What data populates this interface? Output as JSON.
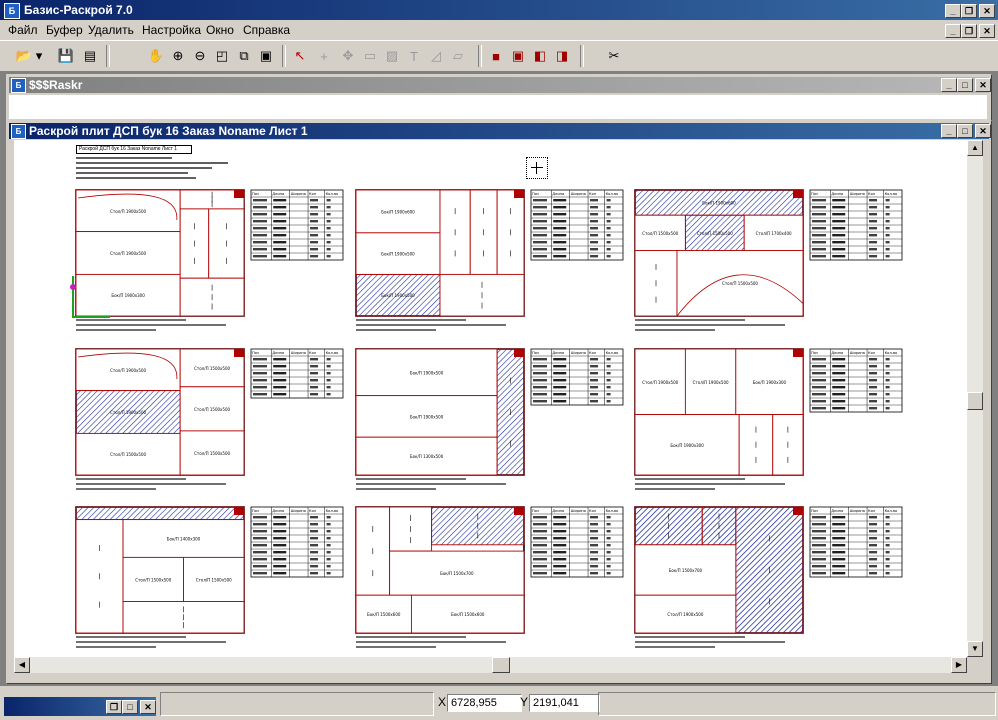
{
  "app": {
    "title": "Базис-Раскрой 7.0"
  },
  "menu": [
    "Файл",
    "Буфер",
    "Удалить",
    "Настройка",
    "Окно",
    "Справка"
  ],
  "toolbar": {
    "buttons": [
      {
        "name": "open-icon",
        "glyph": "📂"
      },
      {
        "name": "dropdown-icon",
        "glyph": "▾"
      },
      {
        "name": "save-icon",
        "glyph": "💾"
      },
      {
        "name": "print-icon",
        "glyph": "▤"
      },
      {
        "name": "hand-pan-icon",
        "glyph": "✋"
      },
      {
        "name": "zoom-in-icon",
        "glyph": "⊕"
      },
      {
        "name": "zoom-out-icon",
        "glyph": "⊖"
      },
      {
        "name": "zoom-window-icon",
        "glyph": "◰"
      },
      {
        "name": "zoom-all-icon",
        "glyph": "⧉"
      },
      {
        "name": "zoom-page-icon",
        "glyph": "▣"
      },
      {
        "name": "select-arrow-icon",
        "glyph": "↖"
      },
      {
        "name": "add-part-icon",
        "glyph": "+"
      },
      {
        "name": "move-part-icon",
        "glyph": "✥"
      },
      {
        "name": "rotate-part-icon",
        "glyph": "▭"
      },
      {
        "name": "hatch-icon",
        "glyph": "▨"
      },
      {
        "name": "text-icon",
        "glyph": "T"
      },
      {
        "name": "edge-icon",
        "glyph": "◿"
      },
      {
        "name": "cut-line-icon",
        "glyph": "▱"
      },
      {
        "name": "box-view-1-icon",
        "glyph": "■"
      },
      {
        "name": "box-view-2-icon",
        "glyph": "▣"
      },
      {
        "name": "box-view-3-icon",
        "glyph": "◧"
      },
      {
        "name": "box-view-4-icon",
        "glyph": "◨"
      },
      {
        "name": "scissors-icon",
        "glyph": "✂"
      }
    ]
  },
  "windows": {
    "raskr": {
      "title": "$$$Raskr"
    },
    "sheet": {
      "title": "Раскрой плит ДСП бук 16 Заказ Noname Лист 1"
    }
  },
  "sheet_header": "Раскрой ДСП бук 16 Заказ Noname Лист 1",
  "table_headers": [
    "Поз",
    "Длина",
    "Ширина",
    "Кол",
    "Кол-во"
  ],
  "sheets": [
    {
      "parts": [
        "Стол/П 1900х500",
        "Бок/П 1900х300"
      ]
    },
    {
      "parts": [
        "Бок/П 1900х600",
        "Полка/П 1900х300",
        "Бок/П 1900х500"
      ]
    },
    {
      "parts": [
        "Бок/П 1900х600",
        "Стол/П 1500х500",
        "Стол/П 1700х400"
      ]
    },
    {
      "parts": [
        "Стол/П 1900х500",
        "Стол/П 1500х500"
      ]
    },
    {
      "parts": [
        "Бок/П 1900х500",
        "Бок/П 1300х500"
      ]
    },
    {
      "parts": [
        "Стол/П 1900х500",
        "Бок/П 1900х300"
      ]
    },
    {
      "parts": [
        "Бок/П 1400х300",
        "Стол/П 1500х500",
        "Полка/П 1900х300"
      ]
    },
    {
      "parts": [
        "Бок/П 1500х700",
        "Бок/П 1500х600"
      ]
    },
    {
      "parts": [
        "Бок/П 1500х700",
        "Стол/П 1900х500"
      ]
    }
  ],
  "taskbar": {
    "minimized_label": ""
  },
  "status": {
    "x_label": "X",
    "x_value": "6728,955",
    "y_label": "Y",
    "y_value": "2191,041"
  },
  "colors": {
    "titlebar": "#0a246a",
    "part_line": "#b00000",
    "hatch": "#2030a0"
  }
}
